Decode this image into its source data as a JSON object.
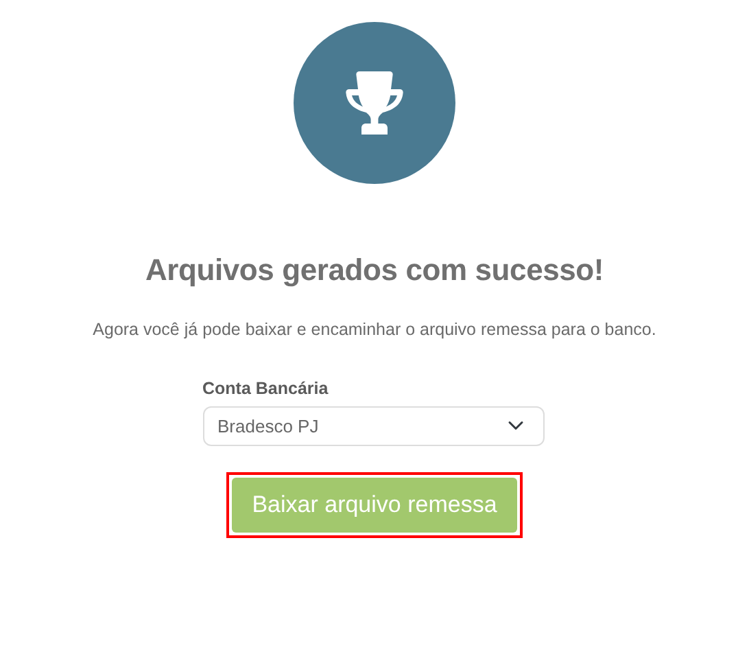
{
  "title": "Arquivos gerados com sucesso!",
  "message": "Agora você já pode baixar e encaminhar o arquivo remessa para o banco.",
  "account_field": {
    "label": "Conta Bancária",
    "value": "Bradesco PJ"
  },
  "download_button": {
    "label": "Baixar arquivo remessa",
    "highlighted": true
  }
}
